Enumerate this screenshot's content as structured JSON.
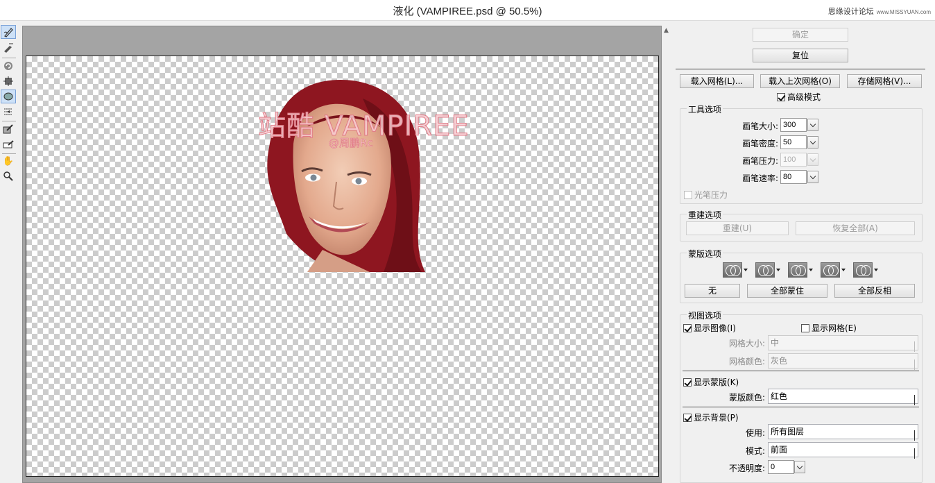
{
  "window": {
    "title": "液化 (VAMPIREE.psd @ 50.5%)",
    "watermark_cn": "思缘设计论坛",
    "watermark_url": "www.MISSYUAN.com"
  },
  "tools": [
    "warp-tool",
    "reconstruct-tool",
    "twirl-clockwise-tool",
    "pucker-tool",
    "bloat-tool",
    "push-left-tool",
    "freeze-mask-tool",
    "thaw-mask-tool",
    "hand-tool",
    "zoom-tool"
  ],
  "canvas": {
    "overlay_title": "站酷 VAMPIREE",
    "overlay_credit": "@周鹏Rc"
  },
  "actions": {
    "ok": "确定",
    "reset": "复位",
    "load_mesh": "载入网格(L)...",
    "load_last_mesh": "载入上次网格(O)",
    "save_mesh": "存储网格(V)...",
    "advanced_mode": "高级模式"
  },
  "tool_options": {
    "title": "工具选项",
    "brush_size_label": "画笔大小:",
    "brush_size": "300",
    "brush_density_label": "画笔密度:",
    "brush_density": "50",
    "brush_pressure_label": "画笔压力:",
    "brush_pressure": "100",
    "brush_rate_label": "画笔速率:",
    "brush_rate": "80",
    "stylus_pressure": "光笔压力"
  },
  "reconstruct_options": {
    "title": "重建选项",
    "reconstruct": "重建(U)",
    "restore_all": "恢复全部(A)"
  },
  "mask_options": {
    "title": "蒙版选项",
    "none": "无",
    "mask_all": "全部蒙住",
    "invert_all": "全部反相"
  },
  "view_options": {
    "title": "视图选项",
    "show_image": "显示图像(I)",
    "show_mesh": "显示网格(E)",
    "mesh_size_label": "网格大小:",
    "mesh_size": "中",
    "mesh_color_label": "网格颜色:",
    "mesh_color": "灰色",
    "show_mask": "显示蒙版(K)",
    "mask_color_label": "蒙版颜色:",
    "mask_color": "红色",
    "show_backdrop": "显示背景(P)",
    "use_label": "使用:",
    "use": "所有图层",
    "mode_label": "模式:",
    "mode": "前面",
    "opacity_label": "不透明度:",
    "opacity": "0"
  }
}
